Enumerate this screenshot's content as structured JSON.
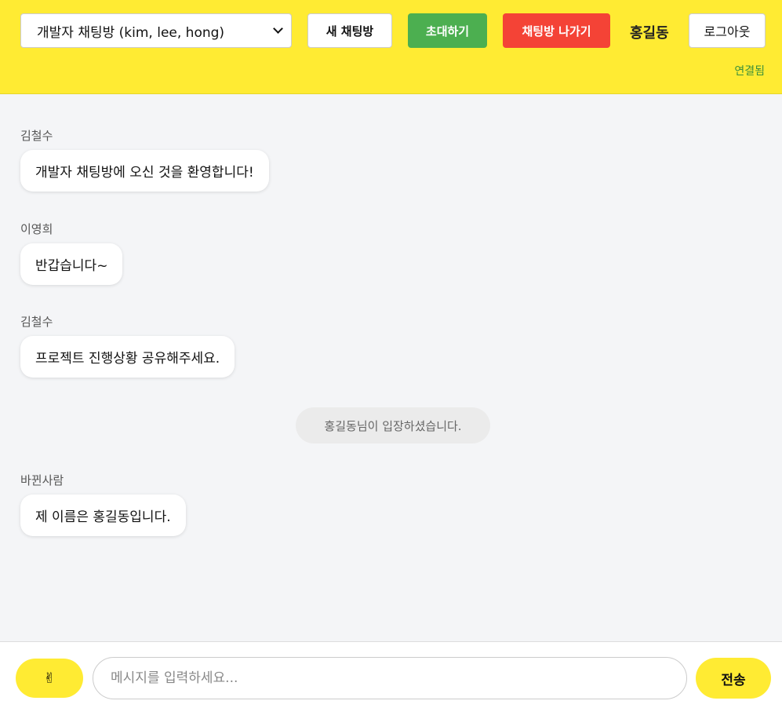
{
  "header": {
    "room_select_value": "개발자 채팅방 (kim, lee, hong)",
    "new_room_label": "새 채팅방",
    "invite_label": "초대하기",
    "leave_label": "채팅방 나가기",
    "username": "홍길동",
    "logout_label": "로그아웃",
    "connection_status": "연결됨"
  },
  "messages": [
    {
      "sender": "김철수",
      "text": "개발자 채팅방에 오신 것을 환영합니다!"
    },
    {
      "sender": "이영희",
      "text": "반갑습니다~"
    },
    {
      "sender": "김철수",
      "text": "프로젝트 진행상황 공유해주세요."
    },
    {
      "sender": "바뀐사람",
      "text": "제 이름은 홍길동입니다."
    }
  ],
  "system_message": "홍길동님이 입장하셨습니다.",
  "input": {
    "emoji_icon": "✌",
    "placeholder": "메시지를 입력하세요...",
    "send_label": "전송"
  },
  "colors": {
    "accent_yellow": "#ffeb33",
    "invite_green": "#4caf50",
    "leave_red": "#f44336",
    "background": "#f4f5f7"
  }
}
